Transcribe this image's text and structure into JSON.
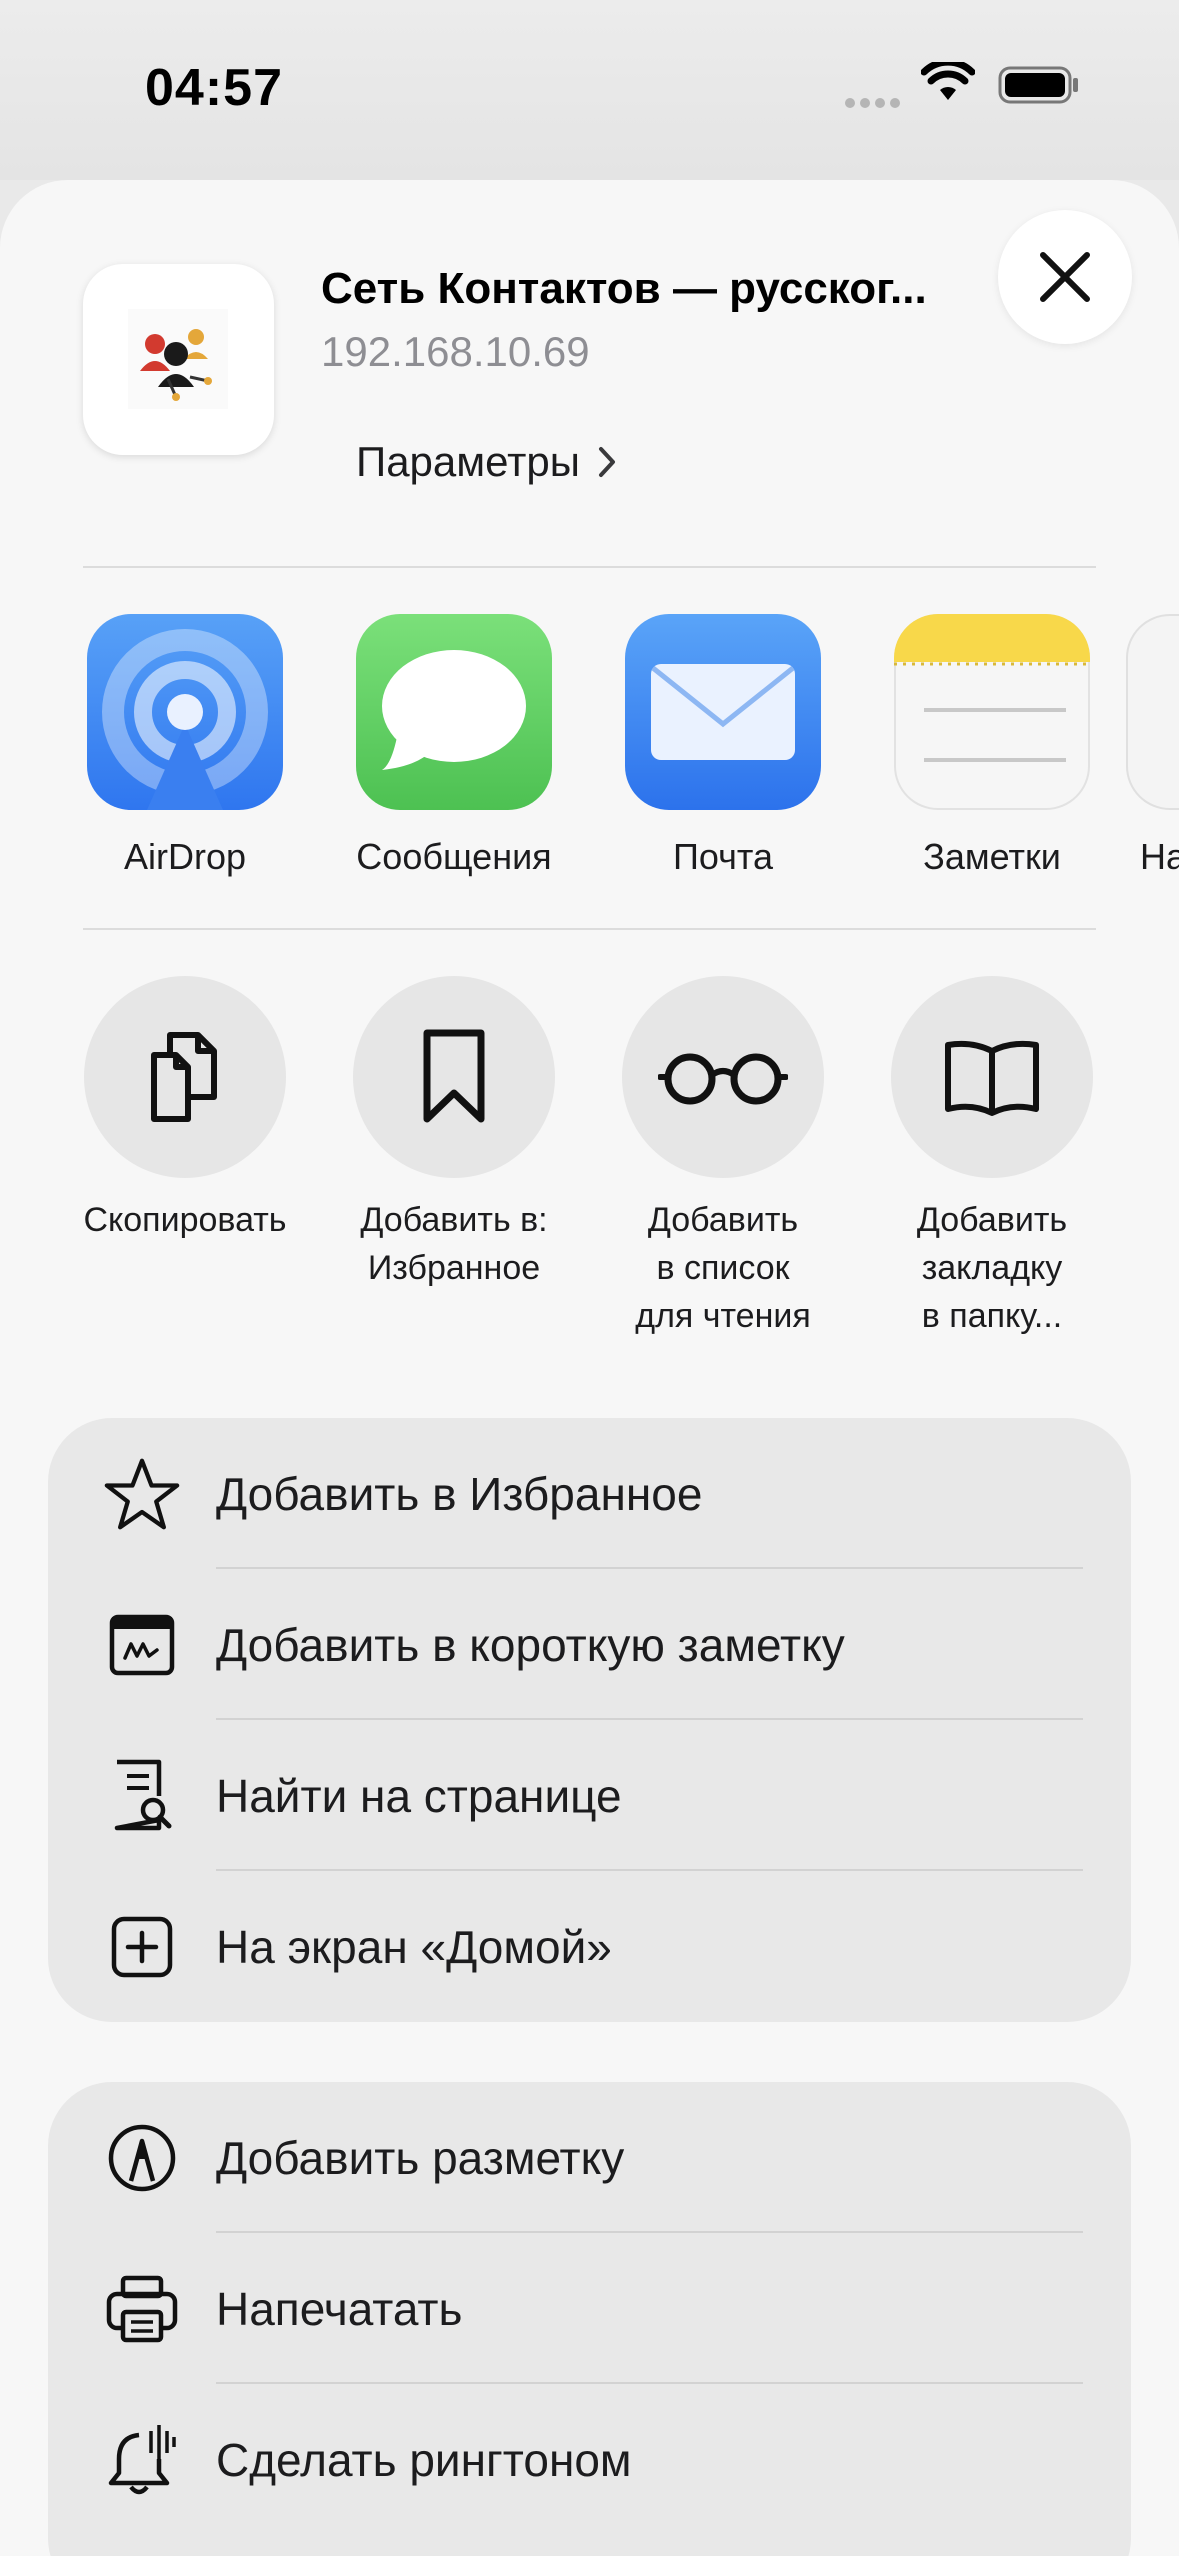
{
  "status_bar": {
    "time": "04:57"
  },
  "header": {
    "title": "Сеть Контактов — русског...",
    "subtitle": "192.168.10.69",
    "options_label": "Параметры"
  },
  "share_apps": [
    {
      "label": "AirDrop",
      "icon": "airdrop-icon"
    },
    {
      "label": "Сообщения",
      "icon": "messages-icon"
    },
    {
      "label": "Почта",
      "icon": "mail-icon"
    },
    {
      "label": "Заметки",
      "icon": "notes-icon"
    },
    {
      "label": "На",
      "icon": "app-icon-partial"
    }
  ],
  "actions": [
    {
      "lines": [
        "Скопировать"
      ],
      "icon": "copy-icon"
    },
    {
      "lines": [
        "Добавить в:",
        "Избранное"
      ],
      "icon": "bookmark-icon"
    },
    {
      "lines": [
        "Добавить",
        "в список",
        "для чтения"
      ],
      "icon": "glasses-icon"
    },
    {
      "lines": [
        "Добавить",
        "закладку",
        "в папку..."
      ],
      "icon": "book-icon"
    }
  ],
  "menu_group_1": [
    {
      "label": "Добавить в Избранное",
      "icon": "star-icon"
    },
    {
      "label": "Добавить в короткую заметку",
      "icon": "quick-note-icon"
    },
    {
      "label": "Найти на странице",
      "icon": "find-on-page-icon"
    },
    {
      "label": "На экран «Домой»",
      "icon": "add-square-icon"
    }
  ],
  "menu_group_2": [
    {
      "label": "Добавить разметку",
      "icon": "markup-icon"
    },
    {
      "label": "Напечатать",
      "icon": "printer-icon"
    },
    {
      "label": "Сделать рингтоном",
      "icon": "bell-icon"
    }
  ],
  "colors": {
    "airdrop": "#3f86f2",
    "messages": "#5bcf5f",
    "mail": "#3c82f1",
    "notes_top": "#f8d84a",
    "secondary_text": "#8e8e93"
  }
}
